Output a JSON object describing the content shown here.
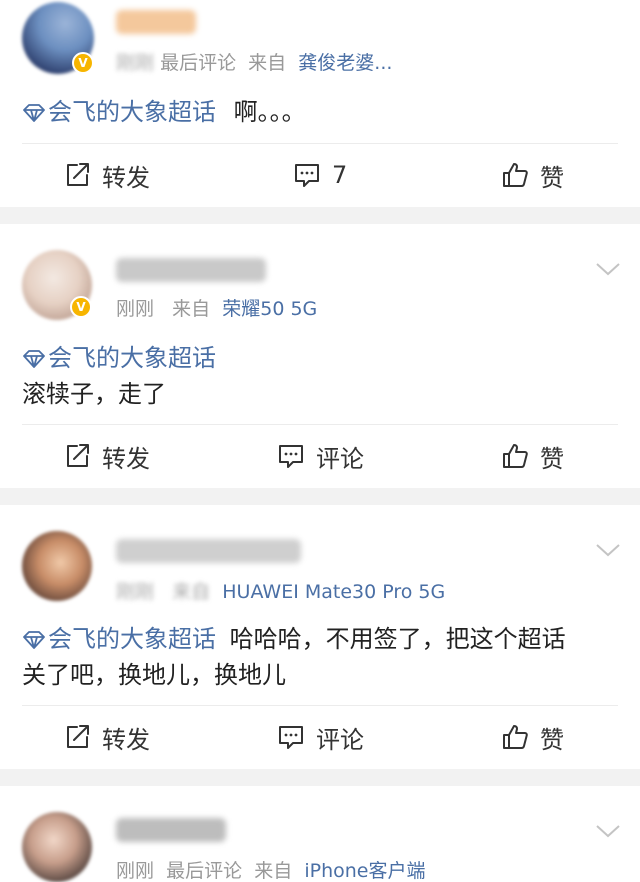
{
  "posts": [
    {
      "meta_time": "刚刚",
      "meta_rest": "最后评论",
      "meta_from": "来自",
      "meta_source": "龚俊老婆...",
      "topic": "会飞的大象超话",
      "text": "啊。。。",
      "actions": {
        "share": "转发",
        "comment": "7",
        "like": "赞"
      }
    },
    {
      "meta_time": "刚刚",
      "meta_from": "来自",
      "meta_source": "荣耀50 5G",
      "topic": "会飞的大象超话",
      "text": "滚犊子，走了",
      "actions": {
        "share": "转发",
        "comment": "评论",
        "like": "赞"
      }
    },
    {
      "meta_time": "刚刚",
      "meta_from": "来自",
      "meta_source": "HUAWEI Mate30 Pro 5G",
      "topic": "会飞的大象超话",
      "text_line1": "哈哈哈，不用签了，把这个超话",
      "text_line2": "关了吧，换地儿，换地儿",
      "actions": {
        "share": "转发",
        "comment": "评论",
        "like": "赞"
      }
    },
    {
      "meta_time": "刚刚",
      "meta_rest": "最后评论",
      "meta_from": "来自",
      "meta_source": "iPhone客户端"
    }
  ],
  "colors": {
    "link": "#4a6fa5",
    "divider": "#f2f2f2",
    "verified": "#f7b500"
  },
  "icons": [
    "share-icon",
    "comment-icon",
    "like-icon",
    "chevron-down-icon",
    "supertopic-diamond-icon",
    "verified-badge-icon"
  ]
}
